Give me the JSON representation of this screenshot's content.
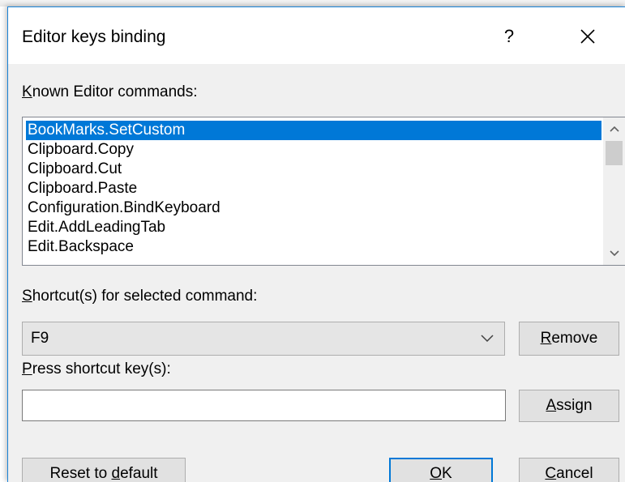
{
  "window": {
    "title": "Editor keys binding",
    "help_glyph": "?",
    "close_glyph": "×"
  },
  "commands": {
    "label_accel": "K",
    "label_rest": "nown Editor commands:",
    "items": [
      {
        "label": "BookMarks.SetCustom",
        "selected": true
      },
      {
        "label": "Clipboard.Copy",
        "selected": false
      },
      {
        "label": "Clipboard.Cut",
        "selected": false
      },
      {
        "label": "Clipboard.Paste",
        "selected": false
      },
      {
        "label": "Configuration.BindKeyboard",
        "selected": false
      },
      {
        "label": "Edit.AddLeadingTab",
        "selected": false
      },
      {
        "label": "Edit.Backspace",
        "selected": false
      }
    ]
  },
  "shortcuts": {
    "label_accel": "S",
    "label_rest": "hortcut(s) for selected command:",
    "selected_value": "F9",
    "remove_accel": "R",
    "remove_rest": "emove"
  },
  "press": {
    "label_accel": "P",
    "label_rest": "ress shortcut key(s):",
    "value": "",
    "assign_accel": "A",
    "assign_rest": "ssign"
  },
  "footer": {
    "reset_pre": "Reset to ",
    "reset_accel": "d",
    "reset_post": "efault",
    "ok_accel": "O",
    "ok_rest": "K",
    "cancel_accel": "C",
    "cancel_rest": "ancel"
  },
  "colors": {
    "selection": "#0078d7",
    "window_border": "#1883d7",
    "dialog_bg": "#f0f0f0"
  }
}
